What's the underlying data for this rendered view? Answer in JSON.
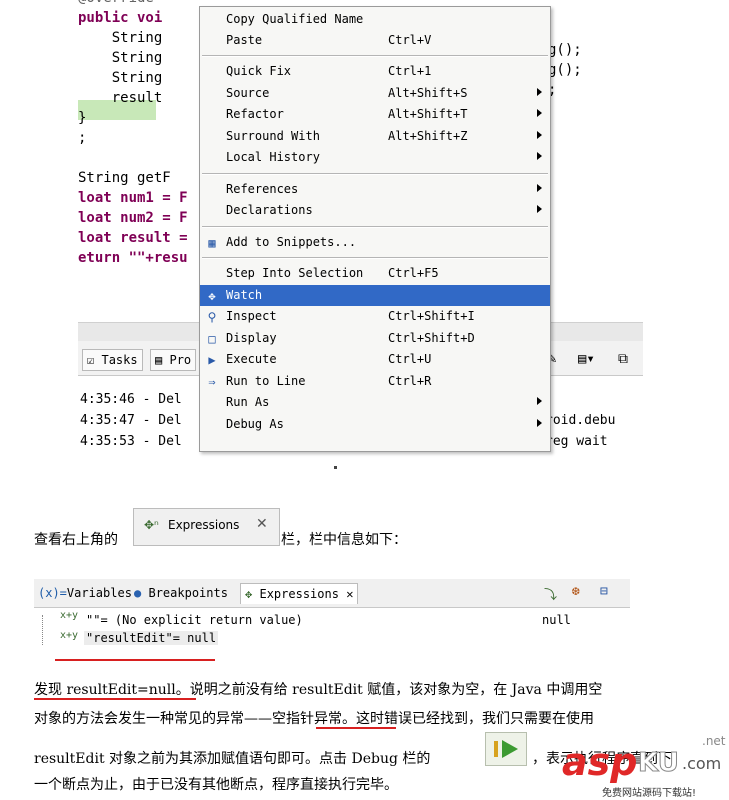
{
  "editor": {
    "lines": [
      {
        "text": "@Override",
        "kind": "annotation"
      },
      {
        "text": "public voi",
        "kind": "kw"
      },
      {
        "text": "    String",
        "kind": "plain"
      },
      {
        "text": "    String",
        "kind": "plain"
      },
      {
        "text": "    String",
        "kind": "plain"
      },
      {
        "text": "    result",
        "kind": "plain"
      },
      {
        "text": "}",
        "kind": "plain"
      },
      {
        "text": ";",
        "kind": "plain"
      },
      {
        "text": "",
        "kind": "plain"
      },
      {
        "text": "String getF",
        "kind": "plain"
      },
      {
        "text": "loat num1 = F",
        "kind": "kw"
      },
      {
        "text": "loat num2 = F",
        "kind": "kw"
      },
      {
        "text": "loat result =",
        "kind": "kw"
      },
      {
        "text": "eturn \"\"+resu",
        "kind": "kw"
      }
    ],
    "right_fragments": [
      "g();",
      "g();",
      ";"
    ]
  },
  "context_menu": {
    "items": [
      {
        "label": "Copy Qualified Name",
        "accel": "",
        "submenu": false,
        "icon": ""
      },
      {
        "label": "Paste",
        "accel": "Ctrl+V",
        "submenu": false,
        "icon": ""
      },
      {
        "sep": true
      },
      {
        "label": "Quick Fix",
        "accel": "Ctrl+1",
        "submenu": false,
        "icon": ""
      },
      {
        "label": "Source",
        "accel": "Alt+Shift+S",
        "submenu": true,
        "icon": ""
      },
      {
        "label": "Refactor",
        "accel": "Alt+Shift+T",
        "submenu": true,
        "icon": ""
      },
      {
        "label": "Surround With",
        "accel": "Alt+Shift+Z",
        "submenu": true,
        "icon": ""
      },
      {
        "label": "Local History",
        "accel": "",
        "submenu": true,
        "icon": ""
      },
      {
        "sep": true
      },
      {
        "label": "References",
        "accel": "",
        "submenu": true,
        "icon": ""
      },
      {
        "label": "Declarations",
        "accel": "",
        "submenu": true,
        "icon": ""
      },
      {
        "sep": true
      },
      {
        "label": "Add to Snippets...",
        "accel": "",
        "submenu": false,
        "icon": "snippet-icon"
      },
      {
        "sep": true
      },
      {
        "label": "Step Into Selection",
        "accel": "Ctrl+F5",
        "submenu": false,
        "icon": ""
      },
      {
        "label": "Watch",
        "accel": "",
        "submenu": false,
        "icon": "watch-icon",
        "selected": true
      },
      {
        "label": "Inspect",
        "accel": "Ctrl+Shift+I",
        "submenu": false,
        "icon": "inspect-icon"
      },
      {
        "label": "Display",
        "accel": "Ctrl+Shift+D",
        "submenu": false,
        "icon": "display-icon"
      },
      {
        "label": "Execute",
        "accel": "Ctrl+U",
        "submenu": false,
        "icon": "execute-icon"
      },
      {
        "label": "Run to Line",
        "accel": "Ctrl+R",
        "submenu": false,
        "icon": "run-to-line-icon"
      },
      {
        "label": "Run As",
        "accel": "",
        "submenu": true,
        "icon": ""
      },
      {
        "label": "Debug As",
        "accel": "",
        "submenu": true,
        "icon": ""
      }
    ]
  },
  "bottom_panel": {
    "tabs": [
      "Tasks",
      "Pro"
    ],
    "console_lines": [
      "4:35:46 - Del",
      "4:35:47 - Del",
      "4:35:53 - Del"
    ],
    "console_right": [
      "roid.debu",
      "reg wait"
    ]
  },
  "article": {
    "p1_before": "查看右上角的",
    "p1_after": "栏，栏中信息如下：",
    "chip_label": "Expressions",
    "p2_line1": "发现 resultEdit=null。说明之前没有给 resultEdit 赋值，该对象为空，在 Java 中调用空",
    "p2_line2": "对象的方法会发生一种常见的异常——空指针异常。这时错误已经找到，我们只需要在使用",
    "p3_line1_a": "resultEdit 对象之前为其添加赋值语句即可。点击 Debug 栏的",
    "p3_line1_b": "，表示执行程序直到下",
    "p3_line2": "一个断点为止，由于已没有其他断点，程序直接执行完毕。"
  },
  "expressions_panel": {
    "tabs": [
      "Variables",
      "Breakpoints",
      "Expressions"
    ],
    "rows": [
      {
        "expr": "\"\"= (No explicit return value)",
        "value": "null"
      },
      {
        "expr": "\"resultEdit\"= null",
        "value": ""
      }
    ]
  },
  "watermark": {
    "brand": "asp",
    "suffix": "KU",
    "tld": ".com",
    "net": ".net",
    "tagline": "免费网站源码下载站!"
  },
  "colors": {
    "keyword": "#7f0055",
    "menu_selection": "#3169c6",
    "underline": "#d82020"
  }
}
